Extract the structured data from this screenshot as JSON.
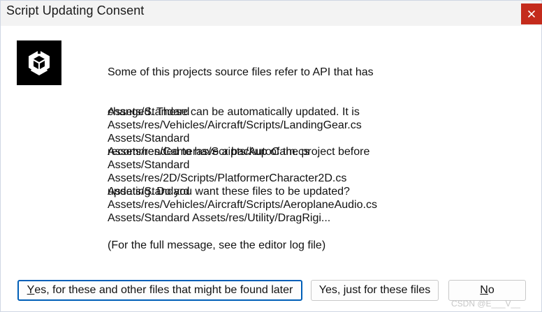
{
  "window": {
    "title": "Script Updating Consent",
    "close_icon": "close-icon"
  },
  "logo": {
    "icon": "unity-logo-icon"
  },
  "message": {
    "lines": [
      "Some of this projects source files refer to API that has",
      "changed. These can be automatically updated. It is",
      "recommended to have a backup of the project before",
      "updating. Do you want these files to be updated?"
    ]
  },
  "files": [
    "Assets/Standard",
    "Assets/res/Vehicles/Aircraft/Scripts/LandingGear.cs",
    "Assets/Standard",
    "Assets/res/Cameras/Scripts/AutoCam.cs",
    "Assets/Standard",
    "Assets/res/2D/Scripts/PlatformerCharacter2D.cs",
    "Assets/Standard",
    "Assets/res/Vehicles/Aircraft/Scripts/AeroplaneAudio.cs",
    "Assets/Standard Assets/res/Utility/DragRigi..."
  ],
  "footnote": "(For the full message, see the editor log file)",
  "buttons": {
    "yes_all": {
      "mnemonic": "Y",
      "rest": "es, for these and other files that might be found later"
    },
    "yes_these": "Yes, just for these files",
    "no": {
      "mnemonic": "N",
      "rest": "o"
    }
  },
  "colors": {
    "close_bg": "#c42b1c",
    "focus_border": "#005fb8",
    "titlebar_bg": "#f3f3f3"
  },
  "watermark": "CSDN @E___V__"
}
